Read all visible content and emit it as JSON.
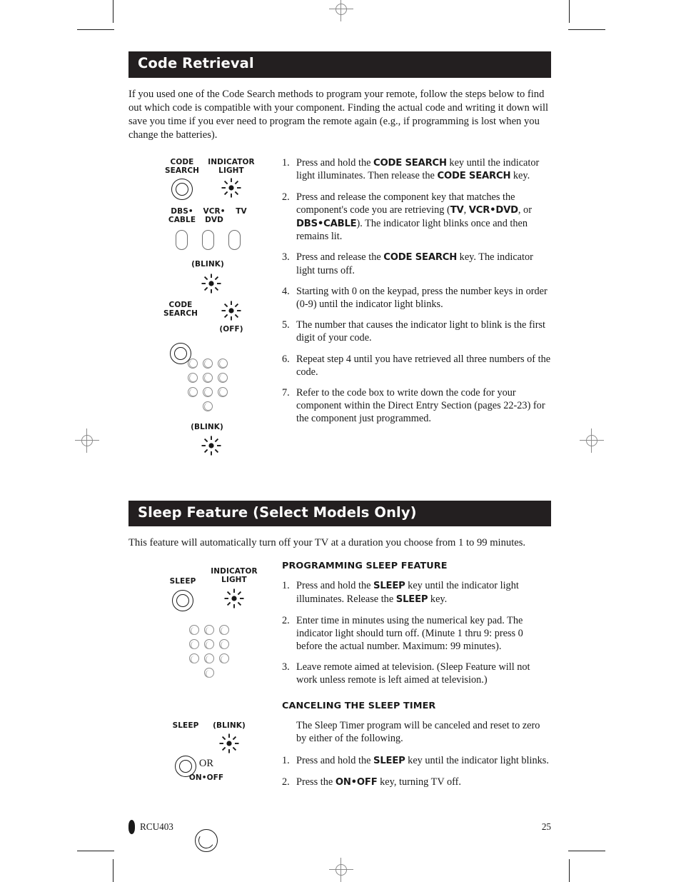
{
  "document": {
    "footer": {
      "model": "RCU403",
      "page_number": "25",
      "remote_icon": "remote-bullet-icon"
    }
  },
  "section_code_retrieval": {
    "title": "Code Retrieval",
    "intro": "If you used one of the Code Search methods to program your remote, follow the steps below to find out which code is compatible with your component. Finding the actual code and writing it down will save you time if you ever need to program the remote again (e.g., if programming is lost when you change the batteries).",
    "diagram": {
      "code_search_label": "CODE\nSEARCH",
      "code_search_label_line1": "CODE",
      "code_search_label_line2": "SEARCH",
      "indicator_light_line1": "INDICATOR",
      "indicator_light_line2": "LIGHT",
      "component_keys": [
        {
          "line1": "DBS•",
          "line2": "CABLE"
        },
        {
          "line1": "VCR•",
          "line2": "DVD"
        },
        {
          "line1": "TV",
          "line2": ""
        }
      ],
      "blink_label_1": "(BLINK)",
      "code_search_2_line1": "CODE",
      "code_search_2_line2": "SEARCH",
      "off_label": "(OFF)",
      "blink_label_2": "(BLINK)"
    },
    "steps": [
      {
        "number": "1.",
        "parts": [
          {
            "t": "Press and hold the ",
            "bold": false
          },
          {
            "t": "CODE SEARCH",
            "bold": true
          },
          {
            "t": " key until the indicator light illuminates. Then release the ",
            "bold": false
          },
          {
            "t": "CODE SEARCH",
            "bold": true
          },
          {
            "t": " key.",
            "bold": false
          }
        ]
      },
      {
        "number": "2.",
        "parts": [
          {
            "t": "Press and release the component key that matches the component's code you are retrieving (",
            "bold": false
          },
          {
            "t": "TV",
            "bold": true
          },
          {
            "t": ", ",
            "bold": false
          },
          {
            "t": "VCR•DVD",
            "bold": true
          },
          {
            "t": ", or ",
            "bold": false
          },
          {
            "t": "DBS•CABLE",
            "bold": true
          },
          {
            "t": "). The indicator light blinks once and then remains lit.",
            "bold": false
          }
        ]
      },
      {
        "number": "3.",
        "parts": [
          {
            "t": "Press and release the ",
            "bold": false
          },
          {
            "t": "CODE SEARCH",
            "bold": true
          },
          {
            "t": " key. The indicator light turns off.",
            "bold": false
          }
        ]
      },
      {
        "number": "4.",
        "parts": [
          {
            "t": "Starting with 0 on the keypad, press the number keys in order (0-9) until the indicator light blinks.",
            "bold": false
          }
        ]
      },
      {
        "number": "5.",
        "parts": [
          {
            "t": "The number that causes the indicator light to blink is the first digit of your code.",
            "bold": false
          }
        ]
      },
      {
        "number": "6.",
        "parts": [
          {
            "t": "Repeat step 4 until you have retrieved all three numbers of the code.",
            "bold": false
          }
        ]
      },
      {
        "number": "7.",
        "parts": [
          {
            "t": "Refer to the code box to write down the code for your component within the Direct Entry Section (pages 22-23) for the component just programmed.",
            "bold": false
          }
        ]
      }
    ]
  },
  "section_sleep_feature": {
    "title": "Sleep Feature (Select Models Only)",
    "intro": "This feature will automatically turn off your TV at a duration you choose from 1 to 99 minutes.",
    "diagram": {
      "sleep_label": "SLEEP",
      "indicator_light_line1": "INDICATOR",
      "indicator_light_line2": "LIGHT",
      "sleep_label_2": "SLEEP",
      "blink_label": "(BLINK)",
      "or_label": "OR",
      "onoff_label": "ON•OFF"
    },
    "programming": {
      "heading": "PROGRAMMING SLEEP FEATURE",
      "steps": [
        {
          "number": "1.",
          "parts": [
            {
              "t": "Press and hold the ",
              "bold": false
            },
            {
              "t": "SLEEP",
              "bold": true
            },
            {
              "t": " key until the indicator light illuminates. Release the ",
              "bold": false
            },
            {
              "t": "SLEEP",
              "bold": true
            },
            {
              "t": " key.",
              "bold": false
            }
          ]
        },
        {
          "number": "2.",
          "parts": [
            {
              "t": "Enter time in minutes using the numerical key pad. The indicator light should turn off. (Minute 1 thru 9: press 0 before the actual number. Maximum: 99 minutes).",
              "bold": false
            }
          ]
        },
        {
          "number": "3.",
          "parts": [
            {
              "t": "Leave remote aimed at television. (Sleep Feature will not work unless remote is left aimed at television.)",
              "bold": false
            }
          ]
        }
      ]
    },
    "canceling": {
      "heading": "CANCELING THE SLEEP TIMER",
      "lead": "The Sleep Timer program will be canceled and reset to zero by either of the following.",
      "steps": [
        {
          "number": "1.",
          "parts": [
            {
              "t": "Press and hold the ",
              "bold": false
            },
            {
              "t": "SLEEP",
              "bold": true
            },
            {
              "t": " key until the indicator light blinks.",
              "bold": false
            }
          ]
        },
        {
          "number": "2.",
          "parts": [
            {
              "t": "Press the ",
              "bold": false
            },
            {
              "t": "ON•OFF",
              "bold": true
            },
            {
              "t": " key, turning TV off.",
              "bold": false
            }
          ]
        }
      ]
    }
  },
  "colors": {
    "bar_background": "#231f20",
    "bar_text": "#ffffff",
    "body_text": "#1a1a1a",
    "mark_gray": "#8a8a8a"
  }
}
